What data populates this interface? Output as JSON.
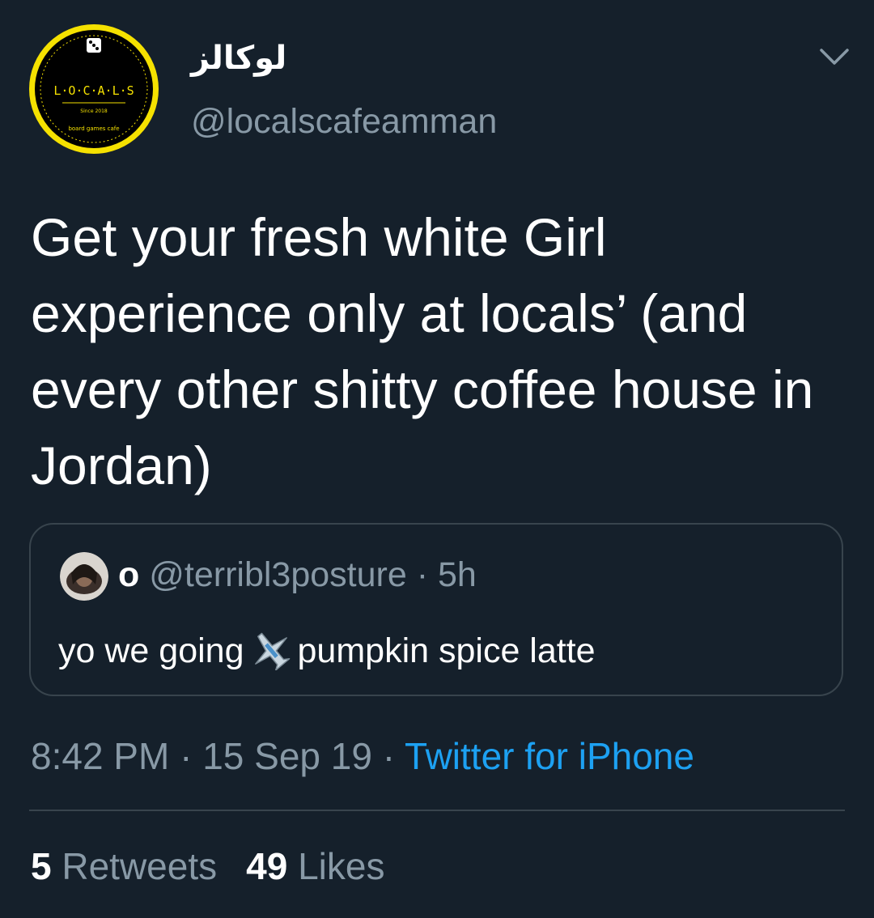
{
  "author": {
    "display_name": "لوكالز",
    "handle": "@localscafeamman",
    "avatar_logo": {
      "wordmark": "L·O·C·A·L·S",
      "since": "Since 2018",
      "tagline": "board games cafe"
    }
  },
  "tweet": {
    "text": "Get your fresh white Girl experience only at locals’ (and every other shitty coffee house in Jordan)"
  },
  "quoted_tweet": {
    "name": "o",
    "handle": "@terribl3posture",
    "separator": "·",
    "time": "5h",
    "text_before": "yo we going",
    "emoji_icon": "airplane-emoji",
    "text_after": "pumpkin spice latte"
  },
  "meta": {
    "time": "8:42 PM",
    "sep1": "·",
    "date": "15 Sep 19",
    "sep2": "·",
    "source": "Twitter for iPhone"
  },
  "stats": {
    "retweets_count": "5",
    "retweets_label": "Retweets",
    "likes_count": "49",
    "likes_label": "Likes"
  },
  "colors": {
    "background": "#15202b",
    "primary_text": "#ffffff",
    "secondary_text": "#8899a6",
    "link": "#1da1f2",
    "border": "#38444d",
    "logo_accent": "#f5e100"
  }
}
